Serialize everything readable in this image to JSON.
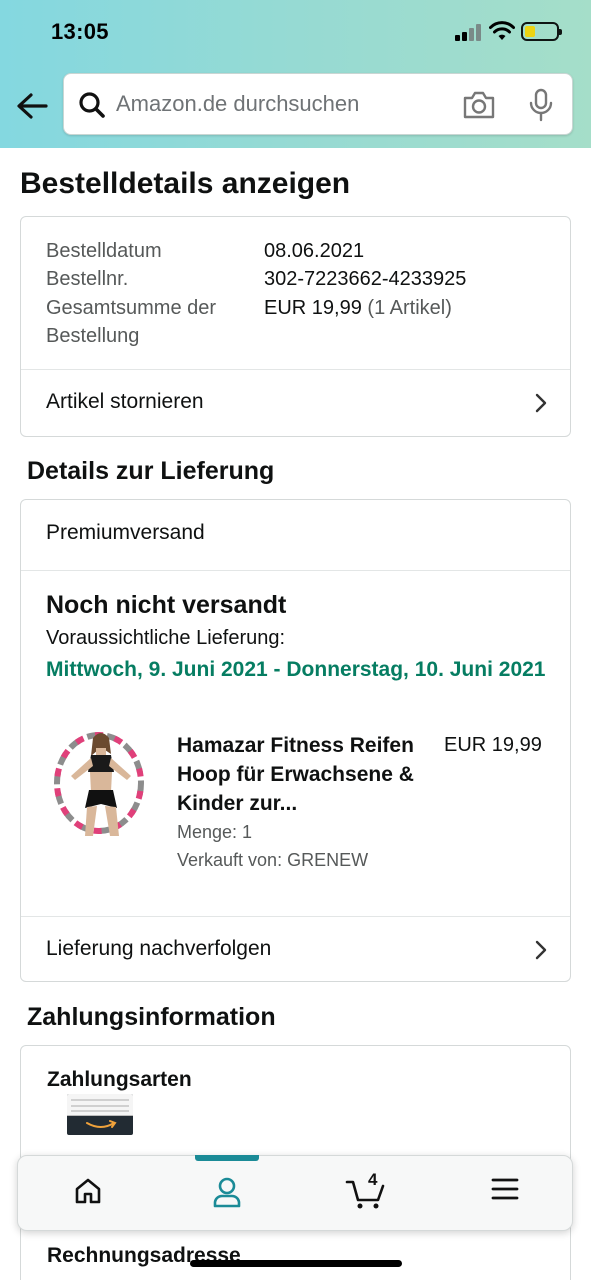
{
  "status_bar": {
    "time": "13:05"
  },
  "search": {
    "placeholder": "Amazon.de durchsuchen"
  },
  "page": {
    "title": "Bestelldetails anzeigen"
  },
  "order": {
    "date_label": "Bestelldatum",
    "date_value": "08.06.2021",
    "number_label": "Bestellnr.",
    "number_value": "302-7223662-4233925",
    "total_label": "Gesamtsumme der Bestellung",
    "total_value": "EUR 19,99",
    "total_items": "(1 Artikel)",
    "cancel_label": "Artikel stornieren"
  },
  "delivery": {
    "section_title": "Details zur Lieferung",
    "shipping_method": "Premiumversand",
    "status": "Noch nicht versandt",
    "estimate_label": "Voraussichtliche Lieferung:",
    "estimate_date": "Mittwoch, 9. Juni 2021 - Donnerstag, 10. Juni 2021",
    "product": {
      "title": "Hamazar Fitness Reifen Hoop für Erwachsene & Kinder zur...",
      "price": "EUR 19,99",
      "quantity": "Menge: 1",
      "seller": "Verkauft von: GRENEW"
    },
    "track_label": "Lieferung nachverfolgen"
  },
  "payment": {
    "section_title": "Zahlungsinformation",
    "methods_label": "Zahlungsarten",
    "billing_label": "Rechnungsadresse"
  },
  "bottom_nav": {
    "items": [
      "home-icon",
      "account-icon",
      "cart-icon",
      "menu-icon"
    ],
    "active": "account",
    "cart_count": "4",
    "accent_color": "#1b8b97"
  },
  "colors": {
    "delivery_green": "#067d62",
    "header_start": "#84d8e0",
    "header_end": "#a5dec9"
  }
}
